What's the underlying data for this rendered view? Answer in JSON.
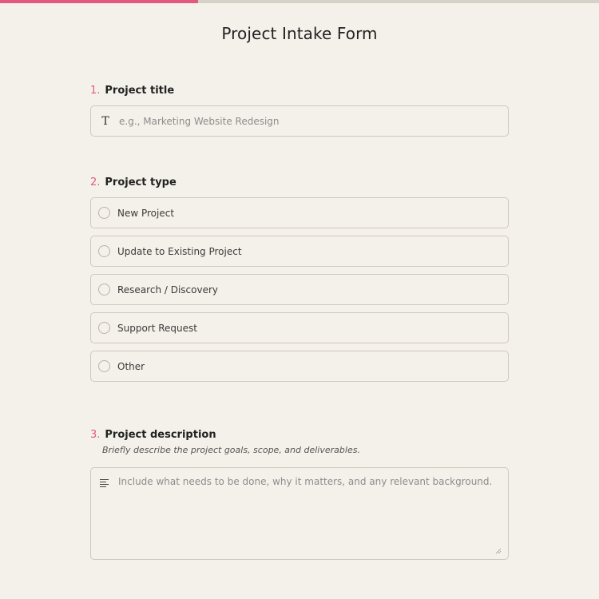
{
  "progress": {
    "fraction": 0.33,
    "fill_color": "#e25a7d",
    "track_color": "#d7d2c8"
  },
  "form": {
    "title": "Project Intake Form"
  },
  "questions": [
    {
      "number": "1.",
      "label": "Project title",
      "input": {
        "icon": "text-type-icon",
        "placeholder": "e.g., Marketing Website Redesign",
        "value": ""
      }
    },
    {
      "number": "2.",
      "label": "Project type",
      "options": [
        {
          "label": "New Project",
          "selected": false
        },
        {
          "label": "Update to Existing Project",
          "selected": false
        },
        {
          "label": "Research / Discovery",
          "selected": false
        },
        {
          "label": "Support Request",
          "selected": false
        },
        {
          "label": "Other",
          "selected": false
        }
      ]
    },
    {
      "number": "3.",
      "label": "Project description",
      "help": "Briefly describe the project goals, scope, and deliverables.",
      "input": {
        "icon": "paragraph-lines-icon",
        "placeholder": "Include what needs to be done, why it matters, and any relevant background.",
        "value": ""
      }
    }
  ]
}
